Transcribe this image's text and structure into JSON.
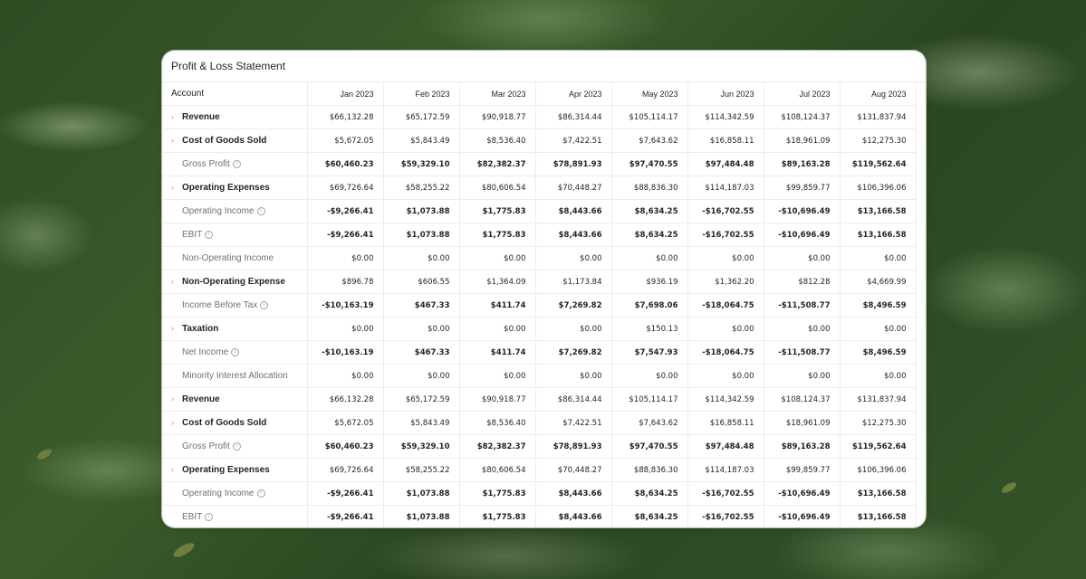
{
  "title": "Profit & Loss Statement",
  "columns": [
    "Account",
    "Jan 2023",
    "Feb 2023",
    "Mar 2023",
    "Apr 2023",
    "May 2023",
    "Jun 2023",
    "Jul 2023",
    "Aug 2023"
  ],
  "rows": [
    {
      "label": "Revenue",
      "type": "group",
      "values": [
        "$66,132.28",
        "$65,172.59",
        "$90,918.77",
        "$86,314.44",
        "$105,114.17",
        "$114,342.59",
        "$108,124.37",
        "$131,837.94"
      ]
    },
    {
      "label": "Cost of Goods Sold",
      "type": "group",
      "values": [
        "$5,672.05",
        "$5,843.49",
        "$8,536.40",
        "$7,422.51",
        "$7,643.62",
        "$16,858.11",
        "$18,961.09",
        "$12,275.30"
      ]
    },
    {
      "label": "Gross Profit",
      "type": "calc",
      "values": [
        "$60,460.23",
        "$59,329.10",
        "$82,382.37",
        "$78,891.93",
        "$97,470.55",
        "$97,484.48",
        "$89,163.28",
        "$119,562.64"
      ]
    },
    {
      "label": "Operating Expenses",
      "type": "group",
      "values": [
        "$69,726.64",
        "$58,255.22",
        "$80,606.54",
        "$70,448.27",
        "$88,836.30",
        "$114,187.03",
        "$99,859.77",
        "$106,396.06"
      ]
    },
    {
      "label": "Operating Income",
      "type": "calc",
      "values": [
        "-$9,266.41",
        "$1,073.88",
        "$1,775.83",
        "$8,443.66",
        "$8,634.25",
        "-$16,702.55",
        "-$10,696.49",
        "$13,166.58"
      ]
    },
    {
      "label": "EBIT",
      "type": "calc",
      "values": [
        "-$9,266.41",
        "$1,073.88",
        "$1,775.83",
        "$8,443.66",
        "$8,634.25",
        "-$16,702.55",
        "-$10,696.49",
        "$13,166.58"
      ]
    },
    {
      "label": "Non-Operating Income",
      "type": "plain",
      "values": [
        "$0.00",
        "$0.00",
        "$0.00",
        "$0.00",
        "$0.00",
        "$0.00",
        "$0.00",
        "$0.00"
      ]
    },
    {
      "label": "Non-Operating Expense",
      "type": "group",
      "values": [
        "$896.78",
        "$606.55",
        "$1,364.09",
        "$1,173.84",
        "$936.19",
        "$1,362.20",
        "$812.28",
        "$4,669.99"
      ]
    },
    {
      "label": "Income Before Tax",
      "type": "calc",
      "values": [
        "-$10,163.19",
        "$467.33",
        "$411.74",
        "$7,269.82",
        "$7,698.06",
        "-$18,064.75",
        "-$11,508.77",
        "$8,496.59"
      ]
    },
    {
      "label": "Taxation",
      "type": "group",
      "values": [
        "$0.00",
        "$0.00",
        "$0.00",
        "$0.00",
        "$150.13",
        "$0.00",
        "$0.00",
        "$0.00"
      ]
    },
    {
      "label": "Net Income",
      "type": "calc",
      "values": [
        "-$10,163.19",
        "$467.33",
        "$411.74",
        "$7,269.82",
        "$7,547.93",
        "-$18,064.75",
        "-$11,508.77",
        "$8,496.59"
      ]
    },
    {
      "label": "Minority Interest Allocation",
      "type": "plain",
      "values": [
        "$0.00",
        "$0.00",
        "$0.00",
        "$0.00",
        "$0.00",
        "$0.00",
        "$0.00",
        "$0.00"
      ]
    },
    {
      "label": "Revenue",
      "type": "group",
      "values": [
        "$66,132.28",
        "$65,172.59",
        "$90,918.77",
        "$86,314.44",
        "$105,114.17",
        "$114,342.59",
        "$108,124.37",
        "$131,837.94"
      ]
    },
    {
      "label": "Cost of Goods Sold",
      "type": "group",
      "values": [
        "$5,672.05",
        "$5,843.49",
        "$8,536.40",
        "$7,422.51",
        "$7,643.62",
        "$16,858.11",
        "$18,961.09",
        "$12,275.30"
      ]
    },
    {
      "label": "Gross Profit",
      "type": "calc",
      "values": [
        "$60,460.23",
        "$59,329.10",
        "$82,382.37",
        "$78,891.93",
        "$97,470.55",
        "$97,484.48",
        "$89,163.28",
        "$119,562.64"
      ]
    },
    {
      "label": "Operating Expenses",
      "type": "group",
      "values": [
        "$69,726.64",
        "$58,255.22",
        "$80,606.54",
        "$70,448.27",
        "$88,836.30",
        "$114,187.03",
        "$99,859.77",
        "$106,396.06"
      ]
    },
    {
      "label": "Operating Income",
      "type": "calc",
      "values": [
        "-$9,266.41",
        "$1,073.88",
        "$1,775.83",
        "$8,443.66",
        "$8,634.25",
        "-$16,702.55",
        "-$10,696.49",
        "$13,166.58"
      ]
    },
    {
      "label": "EBIT",
      "type": "calc",
      "values": [
        "-$9,266.41",
        "$1,073.88",
        "$1,775.83",
        "$8,443.66",
        "$8,634.25",
        "-$16,702.55",
        "-$10,696.49",
        "$13,166.58"
      ]
    }
  ]
}
